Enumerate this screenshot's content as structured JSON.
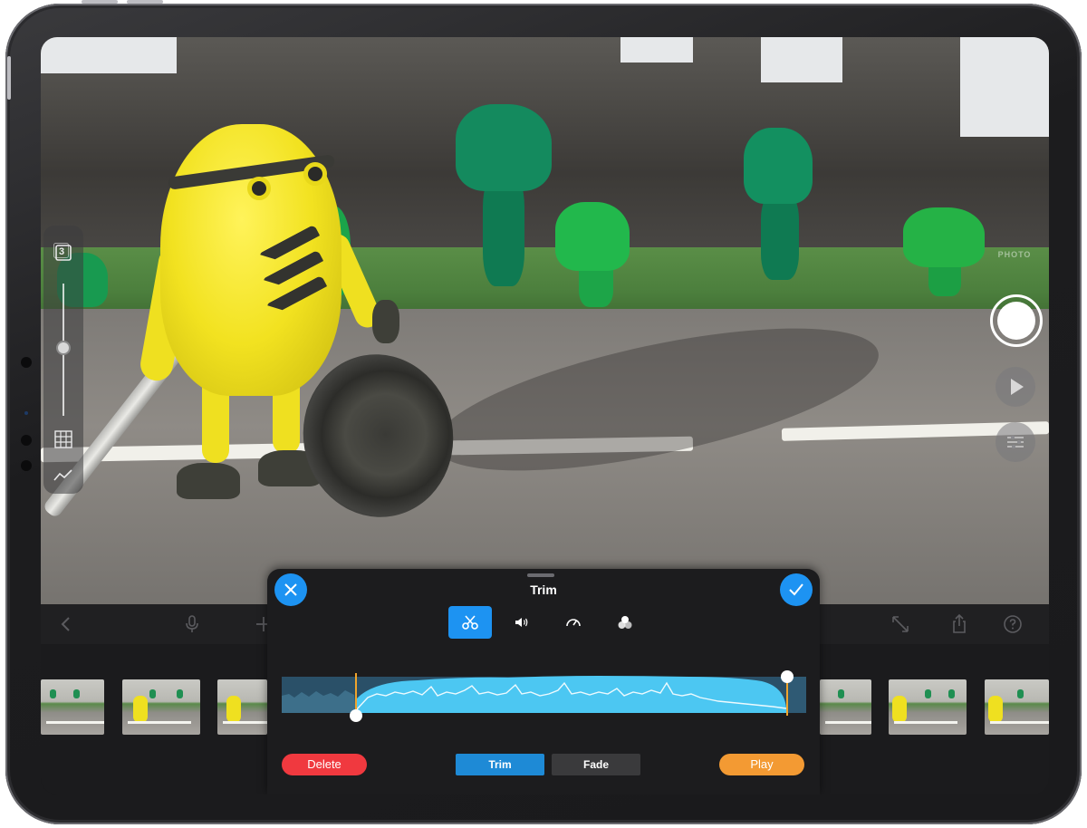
{
  "trim_panel": {
    "title": "Trim",
    "cancel_icon": "close-icon",
    "confirm_icon": "checkmark-icon",
    "tools": [
      {
        "name": "scissors-icon",
        "active": true
      },
      {
        "name": "volume-icon",
        "active": false
      },
      {
        "name": "speed-gauge-icon",
        "active": false
      },
      {
        "name": "color-circles-icon",
        "active": false
      }
    ],
    "buttons": {
      "delete_label": "Delete",
      "trim_label": "Trim",
      "fade_label": "Fade",
      "play_label": "Play"
    },
    "selected_segment": "Trim"
  },
  "camera_controls": {
    "mode_label": "PHOTO",
    "frame_counter": "3"
  },
  "toolbar_icons": [
    "back-chevron-icon",
    "microphone-icon",
    "add-icon",
    "expand-icon",
    "share-icon",
    "help-icon"
  ],
  "colors": {
    "accent_blue": "#1d93f2",
    "delete_red": "#f0393f",
    "play_orange": "#f39a33",
    "trim_selected": "#1e8ad6",
    "fade_unselected": "#3a3a3c",
    "waveform_fill": "#4cc7f2",
    "handle_orange": "#f0a42c"
  }
}
